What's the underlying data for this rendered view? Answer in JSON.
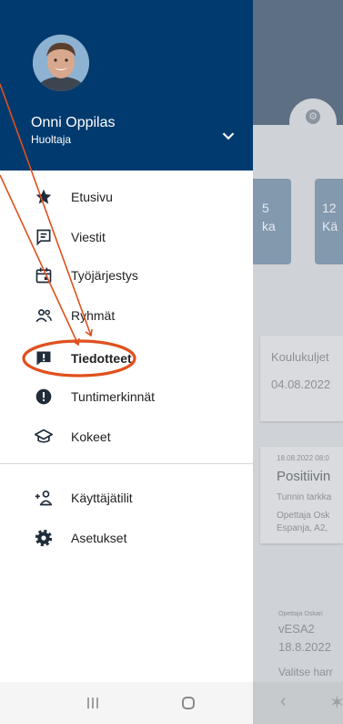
{
  "drawer": {
    "user_name": "Onni Oppilas",
    "user_role": "Huoltaja",
    "items": [
      {
        "label": "Etusivu",
        "icon": "star-icon"
      },
      {
        "label": "Viestit",
        "icon": "message-icon"
      },
      {
        "label": "Työjärjestys",
        "icon": "calendar-icon"
      },
      {
        "label": "Ryhmät",
        "icon": "group-icon"
      },
      {
        "label": "Tiedotteet",
        "icon": "announcement-icon"
      },
      {
        "label": "Tuntimerkinnät",
        "icon": "alert-icon"
      },
      {
        "label": "Kokeet",
        "icon": "graduation-cap-icon"
      },
      {
        "label": "Käyttäjätilit",
        "icon": "add-user-icon"
      },
      {
        "label": "Asetukset",
        "icon": "gear-icon"
      }
    ]
  },
  "background": {
    "tiles": [
      {
        "line1": "5",
        "line2": "ka"
      },
      {
        "line1": "12",
        "line2": "Kä"
      }
    ],
    "card1": {
      "title": "Koulukuljet",
      "date": "04.08.2022"
    },
    "card2": {
      "meta": "18.08.2022 08:0",
      "title": "Positiivin",
      "sub": "Tunnin tarkka",
      "teacher": "Opettaja Osk",
      "course": "Espanja, A2,"
    },
    "card3": {
      "meta": "Opettaja Oskari",
      "title": "vESA2",
      "date": "18.8.2022",
      "text": "Valitse harr"
    }
  },
  "colors": {
    "drawer_header": "#013a6e",
    "annotation": "#e0501d"
  }
}
